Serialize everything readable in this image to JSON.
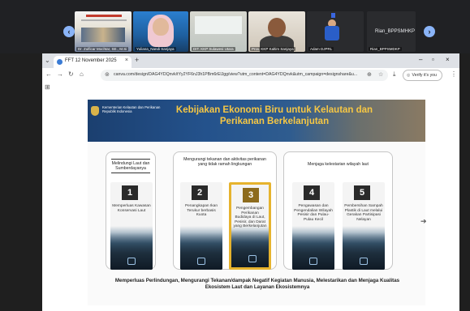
{
  "meeting": {
    "participants": [
      {
        "name": "Dr. Zulficar Mochtar, SE., M.Si"
      },
      {
        "name": "Yuliana_Nandi Sanjaya"
      },
      {
        "name": "DIT. KKP Sulawesi Utara"
      },
      {
        "name": "Prov. KKP Kaltim Sanjaya"
      },
      {
        "name": "Adam DJPRL"
      },
      {
        "name": "Rian_BPPSMDKP"
      }
    ],
    "spotlight_label": "Rian_BPPSMHKP"
  },
  "browser": {
    "tab_title": "FFT 12 November 2025",
    "url": "canva.com/design/DAG4YDQnvk/tYy2YF6nJ3h1PBm6rElJgg/view?utm_content=DAG4YDQnvk&utm_campaign=designshare&u...",
    "verify_label": "Verify it's you"
  },
  "slide": {
    "ministry_line1": "Kementerian Kelautan dan Perikanan",
    "ministry_line2": "Republik Indonesia",
    "title": "Kebijakan Ekonomi Biru untuk Kelautan dan Perikanan Berkelanjutan",
    "panels": [
      {
        "header": "Melindungi Laut dan Sumberdayanya",
        "cards": [
          {
            "num": "1",
            "text": "Memperluas Kawasan Konservasi Laut"
          }
        ]
      },
      {
        "header": "Mengurangi tekanan dan aktivitas perikanan yang tidak ramah lingkungan",
        "cards": [
          {
            "num": "2",
            "text": "Penangkapan Ikan Terukur berbasis Kuota"
          },
          {
            "num": "3",
            "text": "Pengembangan Perikanan Budidaya di Laut, Pesisir, dan Darat yang Berkelanjutan"
          }
        ]
      },
      {
        "header": "Menjaga kelestarian wilayah laut",
        "cards": [
          {
            "num": "4",
            "text": "Pengawasan dan Pengendalian Wilayah Pesisir dan Pulau-Pulau Kecil"
          },
          {
            "num": "5",
            "text": "Pembersihan Sampah Plastik di Laut melalui Gerakan Partisipasi Nelayan"
          }
        ]
      }
    ],
    "footer": "Memperluas Perlindungan, Mengurangi Tekanan/dampak Negatif Kegiatan Manusia, Melestarikan dan Menjaga Kualitas Ekosistem Laut dan Layanan Ekosistemnya"
  }
}
